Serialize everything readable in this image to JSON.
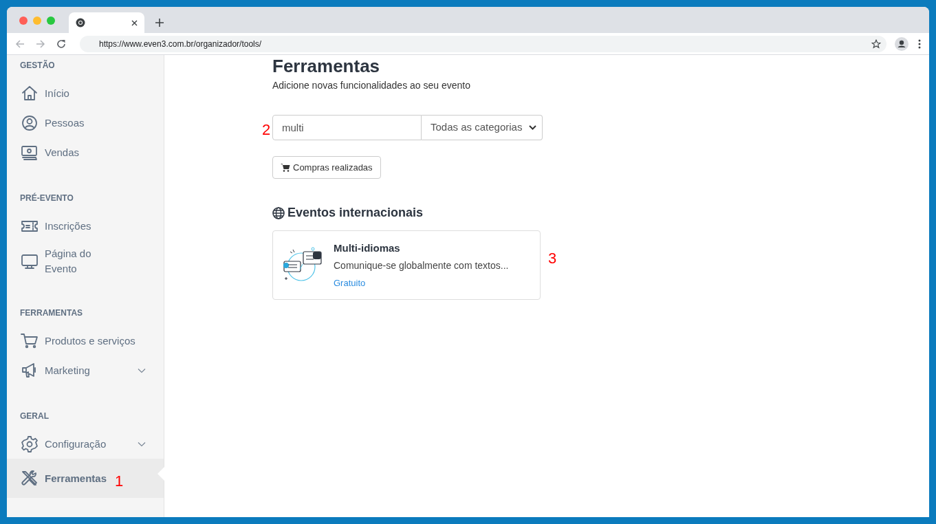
{
  "browser": {
    "address": "https://www.even3.com.br/organizador/tools/"
  },
  "sidebar": {
    "groups": [
      {
        "heading": "GESTÃO",
        "items": [
          {
            "label": "Início",
            "selected": false,
            "has_submenu": false
          },
          {
            "label": "Pessoas",
            "selected": false,
            "has_submenu": false
          },
          {
            "label": "Vendas",
            "selected": false,
            "has_submenu": false
          }
        ]
      },
      {
        "heading": "PRÉ-EVENTO",
        "items": [
          {
            "label": "Inscrições",
            "selected": false,
            "has_submenu": false
          },
          {
            "label": "Página do\nEvento",
            "selected": false,
            "has_submenu": false
          }
        ]
      },
      {
        "heading": "FERRAMENTAS",
        "items": [
          {
            "label": "Produtos e serviços",
            "selected": false,
            "has_submenu": false
          },
          {
            "label": "Marketing",
            "selected": false,
            "has_submenu": true
          }
        ]
      },
      {
        "heading": "GERAL",
        "items": [
          {
            "label": "Configuração",
            "selected": false,
            "has_submenu": true
          },
          {
            "label": "Ferramentas",
            "selected": true,
            "has_submenu": false,
            "annotation": "1"
          }
        ]
      }
    ]
  },
  "page": {
    "title": "Ferramentas",
    "subtitle": "Adicione novas funcionalidades ao seu evento",
    "search": {
      "value": "multi",
      "annotation": "2"
    },
    "category_select": {
      "value": "Todas as categorias"
    },
    "purchases_button": "Compras realizadas",
    "section": {
      "heading": "Eventos internacionais",
      "cards": [
        {
          "title": "Multi-idiomas",
          "description": "Comunique-se globalmente com textos...",
          "price": "Gratuito",
          "annotation": "3"
        }
      ]
    }
  }
}
